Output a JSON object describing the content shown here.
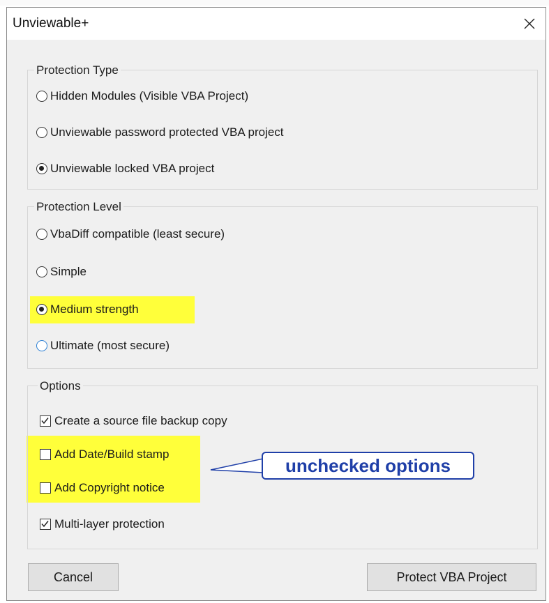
{
  "window": {
    "title": "Unviewable+",
    "close_icon": "close-icon"
  },
  "protection_type": {
    "label": "Protection Type",
    "options": [
      {
        "label": "Hidden Modules (Visible VBA Project)",
        "checked": false
      },
      {
        "label": "Unviewable password protected VBA project",
        "checked": false
      },
      {
        "label": "Unviewable locked VBA project",
        "checked": true
      }
    ]
  },
  "protection_level": {
    "label": "Protection Level",
    "options": [
      {
        "label": "VbaDiff compatible (least secure)",
        "checked": false
      },
      {
        "label": "Simple",
        "checked": false
      },
      {
        "label": "Medium strength",
        "checked": true
      },
      {
        "label": "Ultimate (most secure)",
        "checked": false
      }
    ]
  },
  "options": {
    "label": "Options",
    "items": [
      {
        "label": "Create a source file backup copy",
        "checked": true
      },
      {
        "label": "Add Date/Build stamp",
        "checked": false
      },
      {
        "label": "Add Copyright notice",
        "checked": false
      },
      {
        "label": "Multi-layer protection",
        "checked": true
      }
    ]
  },
  "annotation": {
    "text": "unchecked options",
    "color": "#1f3fa8",
    "highlight_color": "#ffff3a"
  },
  "buttons": {
    "cancel": "Cancel",
    "protect": "Protect VBA Project"
  }
}
